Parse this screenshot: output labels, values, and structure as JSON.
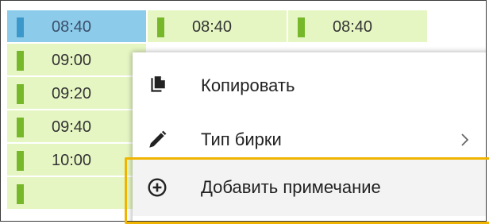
{
  "slots": {
    "col1": [
      "08:40",
      "09:00",
      "09:20",
      "09:40",
      "10:00",
      ""
    ],
    "col2": [
      "08:40",
      "",
      "",
      "",
      "",
      ""
    ],
    "col3": [
      "08:40",
      "",
      "",
      "",
      "",
      ""
    ],
    "selected": "08:40"
  },
  "context_menu": {
    "items": [
      {
        "label": "Копировать",
        "icon": "copy-icon"
      },
      {
        "label": "Тип бирки",
        "icon": "pencil-icon",
        "submenu": true
      },
      {
        "label": "Добавить примечание",
        "icon": "add-circle-icon",
        "highlighted": true
      }
    ]
  },
  "colors": {
    "slot_bg": "#e6f6c3",
    "slot_marker": "#76b82a",
    "selected_bg": "#8ccbea",
    "selected_marker": "#3c98cb",
    "highlight_border": "#f0b400"
  }
}
